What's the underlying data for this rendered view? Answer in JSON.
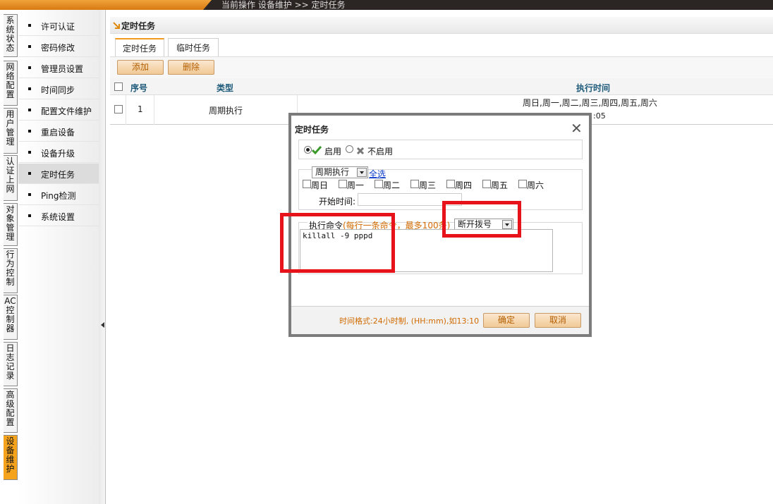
{
  "header": {
    "breadcrumb": "当前操作  设备维护 >> 定时任务",
    "accent_color": "#f29a1c",
    "bar_color": "#2b2523"
  },
  "vertical_tabs": [
    {
      "label": "系统状态",
      "active": false
    },
    {
      "label": "网络配置",
      "active": false
    },
    {
      "label": "用户管理",
      "active": false
    },
    {
      "label": "认证上网",
      "active": false
    },
    {
      "label": "对象管理",
      "active": false
    },
    {
      "label": "行为控制",
      "active": false
    },
    {
      "label": "AC控制器",
      "active": false
    },
    {
      "label": "日志记录",
      "active": false
    },
    {
      "label": "高级配置",
      "active": false
    },
    {
      "label": "设备维护",
      "active": true
    }
  ],
  "menu": {
    "items": [
      {
        "label": "许可认证",
        "active": false
      },
      {
        "label": "密码修改",
        "active": false
      },
      {
        "label": "管理员设置",
        "active": false
      },
      {
        "label": "时间同步",
        "active": false
      },
      {
        "label": "配置文件维护",
        "active": false
      },
      {
        "label": "重启设备",
        "active": false
      },
      {
        "label": "设备升级",
        "active": false
      },
      {
        "label": "定时任务",
        "active": true
      },
      {
        "label": "Ping检测",
        "active": false
      },
      {
        "label": "系统设置",
        "active": false
      }
    ]
  },
  "panel": {
    "title": "定时任务",
    "tabs": [
      {
        "label": "定时任务",
        "active": true
      },
      {
        "label": "临时任务",
        "active": false
      }
    ],
    "toolbar": {
      "add_label": "添加",
      "delete_label": "删除"
    },
    "table": {
      "columns": [
        "序号",
        "类型",
        "执行时间"
      ],
      "rows": [
        {
          "index": "1",
          "type": "周期执行",
          "time_line1": "周日,周一,周二,周三,周四,周五,周六",
          "time_line2": ":05"
        }
      ]
    }
  },
  "dialog": {
    "title": "定时任务",
    "close_icon": "close-icon",
    "enable_label": "启用",
    "disable_label": "不启用",
    "enabled": true,
    "mode_select": "周期执行",
    "select_all_link": "全选",
    "days": [
      "周日",
      "周一",
      "周二",
      "周三",
      "周四",
      "周五",
      "周六"
    ],
    "start_time_label": "开始时间:",
    "start_time_value": "",
    "command_label": "执行命令",
    "command_hint": "(每行一条命令，最多100条)",
    "command_select": "断开拨号",
    "command_text": "killall -9 pppd",
    "footer_hint": "时间格式:24小时制, (HH:mm),如13:10",
    "ok_label": "确定",
    "cancel_label": "取消"
  },
  "annotations": {
    "highlight_color": "#e8131a"
  }
}
